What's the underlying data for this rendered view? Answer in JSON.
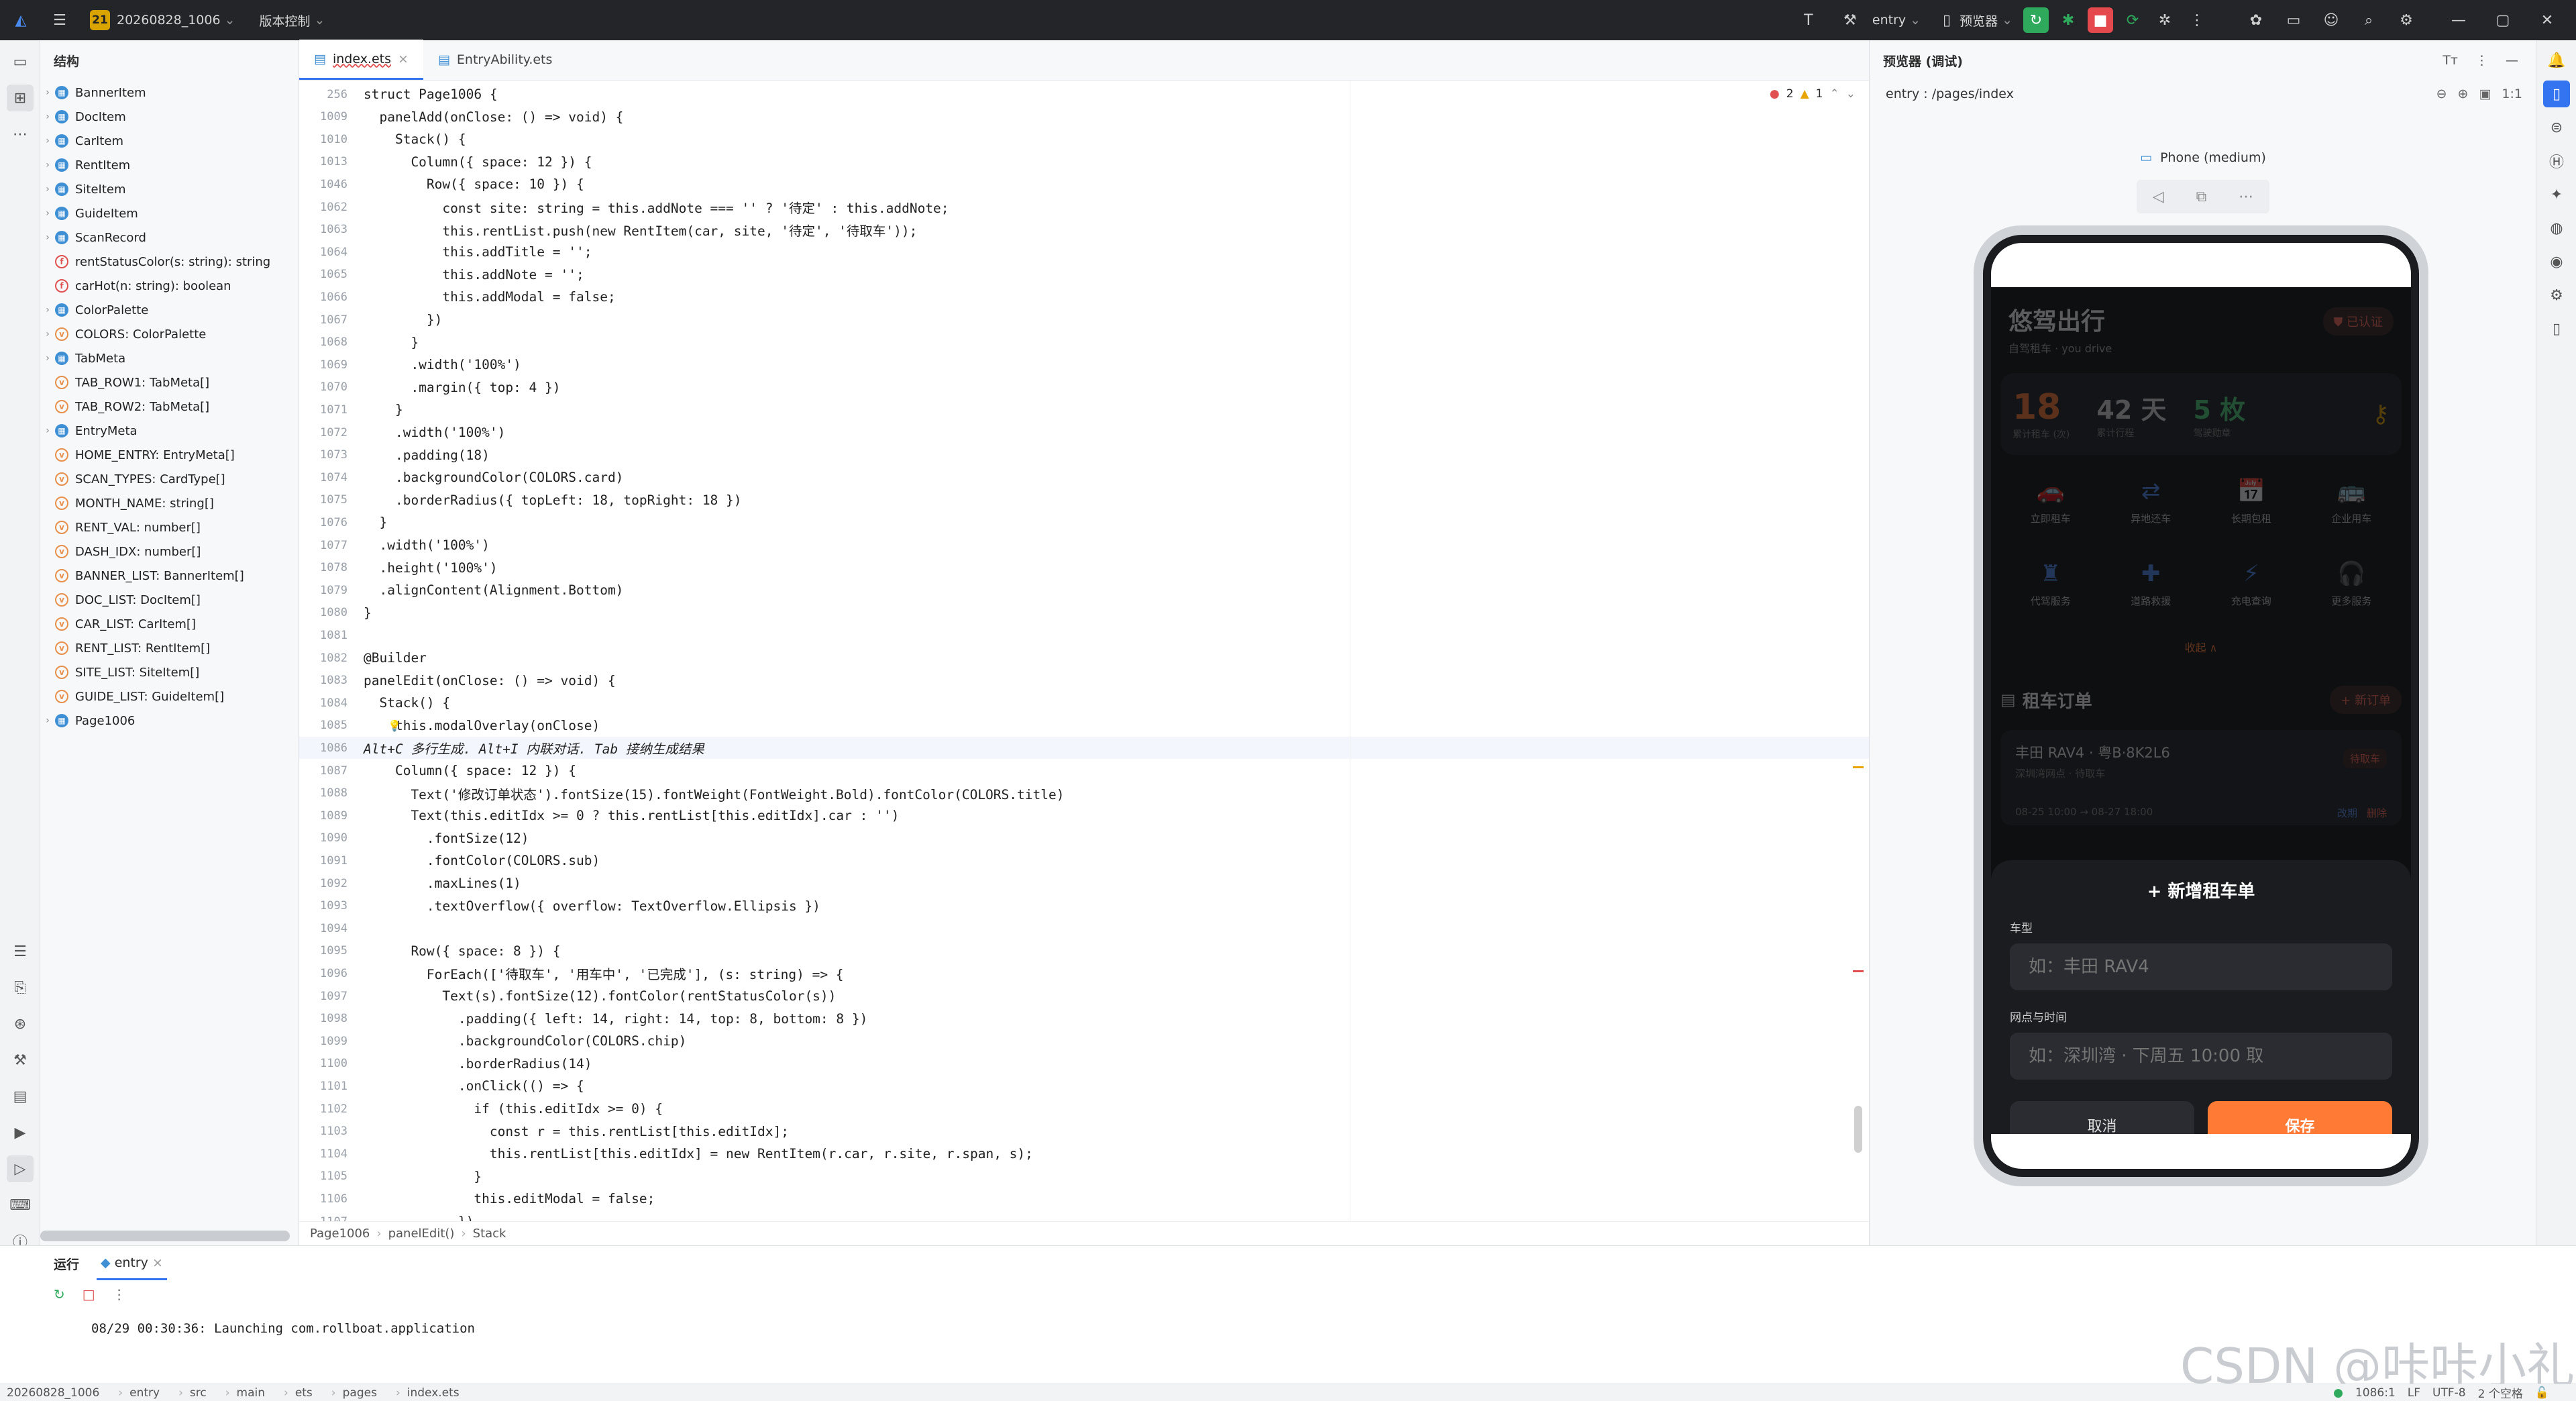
{
  "topbar": {
    "project_number": "21",
    "project_name": "20260828_1006",
    "vcs": "版本控制",
    "run_config": "entry",
    "device": "预览器"
  },
  "structure": {
    "title": "结构",
    "items": [
      {
        "label": "BannerItem",
        "kind": "cls",
        "expand": true
      },
      {
        "label": "DocItem",
        "kind": "cls",
        "expand": true
      },
      {
        "label": "CarItem",
        "kind": "cls",
        "expand": true
      },
      {
        "label": "RentItem",
        "kind": "cls",
        "expand": true
      },
      {
        "label": "SiteItem",
        "kind": "cls",
        "expand": true
      },
      {
        "label": "GuideItem",
        "kind": "cls",
        "expand": true
      },
      {
        "label": "ScanRecord",
        "kind": "cls",
        "expand": true
      },
      {
        "label": "rentStatusColor(s: string): string",
        "kind": "fn",
        "expand": false
      },
      {
        "label": "carHot(n: string): boolean",
        "kind": "fn",
        "expand": false
      },
      {
        "label": "ColorPalette",
        "kind": "cls",
        "expand": true
      },
      {
        "label": "COLORS: ColorPalette",
        "kind": "var",
        "expand": true
      },
      {
        "label": "TabMeta",
        "kind": "cls",
        "expand": true
      },
      {
        "label": "TAB_ROW1: TabMeta[]",
        "kind": "var",
        "expand": false
      },
      {
        "label": "TAB_ROW2: TabMeta[]",
        "kind": "var",
        "expand": false
      },
      {
        "label": "EntryMeta",
        "kind": "cls",
        "expand": true
      },
      {
        "label": "HOME_ENTRY: EntryMeta[]",
        "kind": "var",
        "expand": false
      },
      {
        "label": "SCAN_TYPES: CardType[]",
        "kind": "var",
        "expand": false
      },
      {
        "label": "MONTH_NAME: string[]",
        "kind": "var",
        "expand": false
      },
      {
        "label": "RENT_VAL: number[]",
        "kind": "var",
        "expand": false
      },
      {
        "label": "DASH_IDX: number[]",
        "kind": "var",
        "expand": false
      },
      {
        "label": "BANNER_LIST: BannerItem[]",
        "kind": "var",
        "expand": false
      },
      {
        "label": "DOC_LIST: DocItem[]",
        "kind": "var",
        "expand": false
      },
      {
        "label": "CAR_LIST: CarItem[]",
        "kind": "var",
        "expand": false
      },
      {
        "label": "RENT_LIST: RentItem[]",
        "kind": "var",
        "expand": false
      },
      {
        "label": "SITE_LIST: SiteItem[]",
        "kind": "var",
        "expand": false
      },
      {
        "label": "GUIDE_LIST: GuideItem[]",
        "kind": "var",
        "expand": false
      },
      {
        "label": "Page1006",
        "kind": "cls",
        "expand": true
      }
    ]
  },
  "editor": {
    "tabs": [
      "index.ets",
      "EntryAbility.ets"
    ],
    "errors": "2",
    "warnings": "1",
    "breadcrumb": [
      "Page1006",
      "panelEdit()",
      "Stack"
    ],
    "lines": [
      {
        "n": "256",
        "t": "struct Page1006 {"
      },
      {
        "n": "1009",
        "t": "  panelAdd(onClose: () => void) {"
      },
      {
        "n": "1010",
        "t": "    Stack() {"
      },
      {
        "n": "1013",
        "t": "      Column({ space: 12 }) {"
      },
      {
        "n": "1046",
        "t": "        Row({ space: 10 }) {"
      },
      {
        "n": "1062",
        "t": "          const site: string = this.addNote === '' ? '待定' : this.addNote;"
      },
      {
        "n": "1063",
        "t": "          this.rentList.push(new RentItem(car, site, '待定', '待取车'));"
      },
      {
        "n": "1064",
        "t": "          this.addTitle = '';"
      },
      {
        "n": "1065",
        "t": "          this.addNote = '';"
      },
      {
        "n": "1066",
        "t": "          this.addModal = false;"
      },
      {
        "n": "1067",
        "t": "        })"
      },
      {
        "n": "1068",
        "t": "      }"
      },
      {
        "n": "1069",
        "t": "      .width('100%')"
      },
      {
        "n": "1070",
        "t": "      .margin({ top: 4 })"
      },
      {
        "n": "1071",
        "t": "    }"
      },
      {
        "n": "1072",
        "t": "    .width('100%')"
      },
      {
        "n": "1073",
        "t": "    .padding(18)"
      },
      {
        "n": "1074",
        "t": "    .backgroundColor(COLORS.card)"
      },
      {
        "n": "1075",
        "t": "    .borderRadius({ topLeft: 18, topRight: 18 })"
      },
      {
        "n": "1076",
        "t": "  }"
      },
      {
        "n": "1077",
        "t": "  .width('100%')"
      },
      {
        "n": "1078",
        "t": "  .height('100%')"
      },
      {
        "n": "1079",
        "t": "  .alignContent(Alignment.Bottom)"
      },
      {
        "n": "1080",
        "t": "}"
      },
      {
        "n": "1081",
        "t": ""
      },
      {
        "n": "1082",
        "t": "@Builder"
      },
      {
        "n": "1083",
        "t": "panelEdit(onClose: () => void) {"
      },
      {
        "n": "1084",
        "t": "  Stack() {"
      },
      {
        "n": "1085",
        "t": "    this.modalOverlay(onClose)"
      },
      {
        "n": "1086",
        "t": "Alt+C 多行生成. Alt+I 内联对话. Tab 接纳生成结果"
      },
      {
        "n": "1087",
        "t": "    Column({ space: 12 }) {"
      },
      {
        "n": "1088",
        "t": "      Text('修改订单状态').fontSize(15).fontWeight(FontWeight.Bold).fontColor(COLORS.title)"
      },
      {
        "n": "1089",
        "t": "      Text(this.editIdx >= 0 ? this.rentList[this.editIdx].car : '')"
      },
      {
        "n": "1090",
        "t": "        .fontSize(12)"
      },
      {
        "n": "1091",
        "t": "        .fontColor(COLORS.sub)"
      },
      {
        "n": "1092",
        "t": "        .maxLines(1)"
      },
      {
        "n": "1093",
        "t": "        .textOverflow({ overflow: TextOverflow.Ellipsis })"
      },
      {
        "n": "1094",
        "t": ""
      },
      {
        "n": "1095",
        "t": "      Row({ space: 8 }) {"
      },
      {
        "n": "1096",
        "t": "        ForEach(['待取车', '用车中', '已完成'], (s: string) => {"
      },
      {
        "n": "1097",
        "t": "          Text(s).fontSize(12).fontColor(rentStatusColor(s))"
      },
      {
        "n": "1098",
        "t": "            .padding({ left: 14, right: 14, top: 8, bottom: 8 })"
      },
      {
        "n": "1099",
        "t": "            .backgroundColor(COLORS.chip)"
      },
      {
        "n": "1100",
        "t": "            .borderRadius(14)"
      },
      {
        "n": "1101",
        "t": "            .onClick(() => {"
      },
      {
        "n": "1102",
        "t": "              if (this.editIdx >= 0) {"
      },
      {
        "n": "1103",
        "t": "                const r = this.rentList[this.editIdx];"
      },
      {
        "n": "1104",
        "t": "                this.rentList[this.editIdx] = new RentItem(r.car, r.site, r.span, s);"
      },
      {
        "n": "1105",
        "t": "              }"
      },
      {
        "n": "1106",
        "t": "              this.editModal = false;"
      },
      {
        "n": "1107",
        "t": "            })"
      }
    ]
  },
  "preview": {
    "title": "预览器 (调试)",
    "path": "entry : /pages/index",
    "device": "Phone (medium)",
    "app": {
      "title": "悠驾出行",
      "subtitle": "自驾租车 · you drive",
      "verified": "已认证",
      "stats": [
        {
          "value": "18",
          "label": "累计租车 (次)"
        },
        {
          "value": "42 天",
          "label": "累计行程"
        },
        {
          "value": "5 枚",
          "label": "驾驶勋章"
        }
      ],
      "grid": [
        {
          "icon": "car-icon",
          "label": "立即租车"
        },
        {
          "icon": "swap-icon",
          "label": "异地还车"
        },
        {
          "icon": "calendar-icon",
          "label": "长期包租"
        },
        {
          "icon": "bus-icon",
          "label": "企业用车"
        },
        {
          "icon": "driver-icon",
          "label": "代驾服务"
        },
        {
          "icon": "rescue-icon",
          "label": "道路救援"
        },
        {
          "icon": "charge-icon",
          "label": "充电查询"
        },
        {
          "icon": "headset-icon",
          "label": "更多服务"
        }
      ],
      "collapse": "收起 ∧",
      "order_title": "租车订单",
      "new_order": "+ 新订单",
      "order": {
        "car": "丰田 RAV4 · 粤B·8K2L6",
        "site": "深圳湾网点 · 待取车",
        "status": "待取车",
        "time": "08-25 10:00 → 08-27 18:00",
        "edit": "改期",
        "cancel": "删除"
      },
      "modal": {
        "title": "+ 新增租车单",
        "car_label": "车型",
        "car_placeholder": "如：丰田 RAV4",
        "site_label": "网点与时间",
        "site_placeholder": "如：深圳湾 · 下周五 10:00 取",
        "cancel": "取消",
        "save": "保存"
      }
    }
  },
  "run": {
    "tab": "运行",
    "config": "entry",
    "log": "08/29 00:30:36: Launching com.rollboat.application"
  },
  "statusbar": {
    "path": [
      "20260828_1006",
      "entry",
      "src",
      "main",
      "ets",
      "pages",
      "index.ets"
    ],
    "position": "1086:1",
    "line_ending": "LF",
    "encoding": "UTF-8",
    "indent": "2 个空格"
  },
  "watermark": "CSDN @咔咔小礼"
}
